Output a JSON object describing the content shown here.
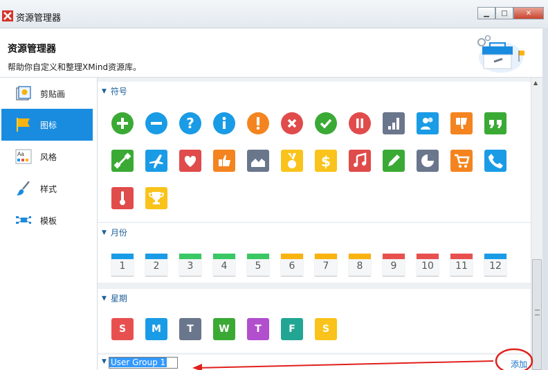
{
  "window": {
    "title": "资源管理器",
    "minimize": "▁",
    "maximize": "□",
    "close": "✕"
  },
  "header": {
    "title": "资源管理器",
    "subtitle": "帮助你自定义和整理XMind资源库。"
  },
  "sidebar": {
    "items": [
      {
        "label": "剪贴画",
        "icon": "clipart-icon",
        "active": false
      },
      {
        "label": "图标",
        "icon": "flag-icon",
        "active": true
      },
      {
        "label": "风格",
        "icon": "style-icon",
        "active": false
      },
      {
        "label": "样式",
        "icon": "brush-icon",
        "active": false
      },
      {
        "label": "模板",
        "icon": "template-icon",
        "active": false
      }
    ]
  },
  "sections": {
    "symbols": {
      "title": "符号",
      "icons": [
        {
          "name": "plus",
          "color": "#3aaa35"
        },
        {
          "name": "minus",
          "color": "#1a9be6"
        },
        {
          "name": "question",
          "color": "#1a9be6"
        },
        {
          "name": "info",
          "color": "#1a9be6"
        },
        {
          "name": "exclaim",
          "color": "#f4841f"
        },
        {
          "name": "cross",
          "color": "#e04b4b"
        },
        {
          "name": "check",
          "color": "#3aaa35"
        },
        {
          "name": "pause",
          "color": "#e04b4b"
        },
        {
          "name": "bar-chart",
          "color": "#6a768c"
        },
        {
          "name": "people",
          "color": "#1a9be6"
        },
        {
          "name": "thumb-down",
          "color": "#f4841f"
        },
        {
          "name": "quote",
          "color": "#3aaa35"
        },
        {
          "name": "dumbbell",
          "color": "#3aaa35"
        },
        {
          "name": "plane",
          "color": "#1a9be6"
        },
        {
          "name": "heart",
          "color": "#e04b4b"
        },
        {
          "name": "thumb-up",
          "color": "#f4841f"
        },
        {
          "name": "area-chart",
          "color": "#6a768c"
        },
        {
          "name": "medal",
          "color": "#f9c31b"
        },
        {
          "name": "dollar",
          "color": "#f9c31b"
        },
        {
          "name": "music",
          "color": "#e04b4b"
        },
        {
          "name": "pencil",
          "color": "#3aaa35"
        },
        {
          "name": "pie-chart",
          "color": "#6a768c"
        },
        {
          "name": "cart",
          "color": "#f4841f"
        },
        {
          "name": "phone",
          "color": "#1a9be6"
        },
        {
          "name": "thermometer",
          "color": "#e04b4b"
        },
        {
          "name": "trophy",
          "color": "#f9c31b"
        }
      ]
    },
    "months": {
      "title": "月份",
      "items": [
        {
          "label": "1",
          "color": "#1a9be6"
        },
        {
          "label": "2",
          "color": "#1a9be6"
        },
        {
          "label": "3",
          "color": "#3ac864"
        },
        {
          "label": "4",
          "color": "#3ac864"
        },
        {
          "label": "5",
          "color": "#3ac864"
        },
        {
          "label": "6",
          "color": "#f9b30f"
        },
        {
          "label": "7",
          "color": "#f9b30f"
        },
        {
          "label": "8",
          "color": "#f9b30f"
        },
        {
          "label": "9",
          "color": "#e85050"
        },
        {
          "label": "10",
          "color": "#e85050"
        },
        {
          "label": "11",
          "color": "#e85050"
        },
        {
          "label": "12",
          "color": "#1a9be6"
        }
      ]
    },
    "weekdays": {
      "title": "星期",
      "items": [
        {
          "label": "S",
          "color": "#e85050"
        },
        {
          "label": "M",
          "color": "#1a9be6"
        },
        {
          "label": "T",
          "color": "#6a768c"
        },
        {
          "label": "W",
          "color": "#3aaa35"
        },
        {
          "label": "T",
          "color": "#b14fcf"
        },
        {
          "label": "F",
          "color": "#22a693"
        },
        {
          "label": "S",
          "color": "#f9c31b"
        }
      ]
    }
  },
  "new_group": {
    "value": "User Group 1",
    "add_label": "添加"
  }
}
